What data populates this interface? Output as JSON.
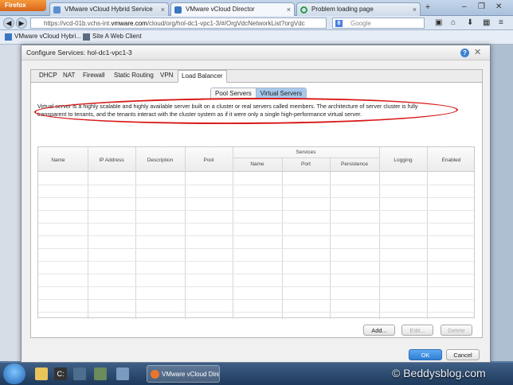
{
  "browser": {
    "firefox_label": "Firefox",
    "tabs": [
      {
        "title": "VMware vCloud Hybrid Service"
      },
      {
        "title": "VMware vCloud Director"
      },
      {
        "title": "Problem loading page"
      }
    ],
    "new_tab": "+",
    "url_prefix": "https://vcd-01b.vchs-int.",
    "url_domain": "vmware.com",
    "url_suffix": "/cloud/org/hol-dc1-vpc1-3/#/OrgVdcNetworkList?orgVdc",
    "search_placeholder": "Google",
    "search_engine_letter": "8"
  },
  "bookmarks": [
    {
      "label": "VMware vCloud Hybri..."
    },
    {
      "label": "Site A Web Client"
    }
  ],
  "dialog": {
    "title": "Configure Services: hol-dc1-vpc1-3",
    "help": "?",
    "close": "✕",
    "tabs": [
      "DHCP",
      "NAT",
      "Firewall",
      "Static Routing",
      "VPN",
      "Load Balancer"
    ],
    "active_tab": "Load Balancer",
    "segments": [
      "Pool Servers",
      "Virtual Servers"
    ],
    "active_segment": "Virtual Servers",
    "description": "Virtual server is a highly scalable and highly available server built on a cluster or real servers called members. The architecture of server cluster is fully transparent to tenants, and the tenants interact with the cluster system as if it were only a single high-performance virtual server.",
    "table": {
      "columns": [
        "Name",
        "IP Address",
        "Description",
        "Pool",
        "Logging",
        "Enabled"
      ],
      "group_header": "Services",
      "sub_columns": [
        "Name",
        "Port",
        "Persistence"
      ]
    },
    "buttons": {
      "add": "Add...",
      "edit": "Edit...",
      "delete": "Delete",
      "ok": "OK",
      "cancel": "Cancel"
    }
  },
  "taskbar": {
    "task_label": "VMware vCloud Dire...",
    "watermark": "© Beddysblog.com"
  }
}
